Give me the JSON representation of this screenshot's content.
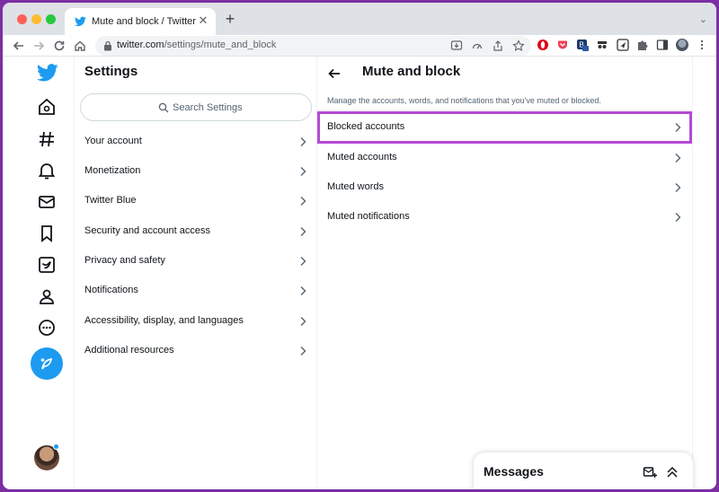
{
  "browser": {
    "tab_title": "Mute and block / Twitter",
    "tab_close": "✕",
    "new_tab": "+",
    "url_host": "twitter.com",
    "url_path": "/settings/mute_and_block",
    "tab_menu": "⌄"
  },
  "nav": {
    "icons": [
      "twitter-logo",
      "home-icon",
      "explore-icon",
      "notifications-icon",
      "messages-icon",
      "bookmarks-icon",
      "twitter-blue-icon",
      "profile-icon",
      "more-icon",
      "compose-icon"
    ]
  },
  "settings": {
    "title": "Settings",
    "search_placeholder": "Search Settings",
    "items": [
      {
        "label": "Your account"
      },
      {
        "label": "Monetization"
      },
      {
        "label": "Twitter Blue"
      },
      {
        "label": "Security and account access"
      },
      {
        "label": "Privacy and safety"
      },
      {
        "label": "Notifications"
      },
      {
        "label": "Accessibility, display, and languages"
      },
      {
        "label": "Additional resources"
      }
    ]
  },
  "mute_block": {
    "title": "Mute and block",
    "description": "Manage the accounts, words, and notifications that you've muted or blocked.",
    "items": [
      {
        "label": "Blocked accounts"
      },
      {
        "label": "Muted accounts"
      },
      {
        "label": "Muted words"
      },
      {
        "label": "Muted notifications"
      }
    ]
  },
  "messages": {
    "title": "Messages"
  },
  "colors": {
    "twitter_blue": "#1d9bf0",
    "highlight": "#b44ad3",
    "text_primary": "#0f1419",
    "text_secondary": "#536471"
  }
}
